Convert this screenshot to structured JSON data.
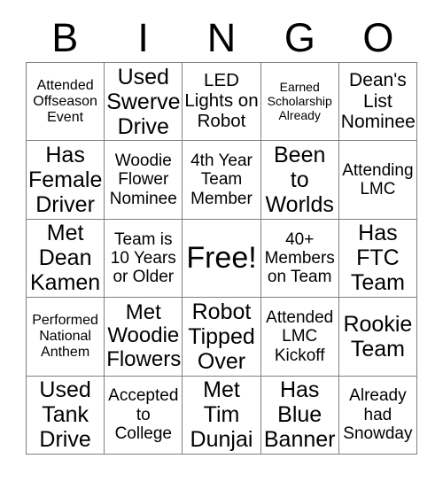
{
  "card": {
    "title": "BINGO",
    "header_letters": [
      "B",
      "I",
      "N",
      "G",
      "O"
    ],
    "columns": 5,
    "rows": 5,
    "free_space": {
      "row": 3,
      "column": 3,
      "label": "Free!"
    },
    "colors": {
      "background": "#ffffff",
      "text": "#000000",
      "grid_line": "#808080"
    },
    "cells": [
      [
        {
          "text": "Attended Offseason Event",
          "size": "sm",
          "free": false
        },
        {
          "text": "Used Swerve Drive",
          "size": "xl",
          "free": false
        },
        {
          "text": "LED Lights on Robot",
          "size": "lg",
          "free": false
        },
        {
          "text": "Earned Scholarship Already",
          "size": "xs",
          "free": false
        },
        {
          "text": "Dean's List Nominee",
          "size": "lg",
          "free": false
        }
      ],
      [
        {
          "text": "Has Female Driver",
          "size": "xl",
          "free": false
        },
        {
          "text": "Woodie Flower Nominee",
          "size": "md",
          "free": false
        },
        {
          "text": "4th Year Team Member",
          "size": "md",
          "free": false
        },
        {
          "text": "Been to Worlds",
          "size": "xl",
          "free": false
        },
        {
          "text": "Attending LMC",
          "size": "md",
          "free": false
        }
      ],
      [
        {
          "text": "Met Dean Kamen",
          "size": "xl",
          "free": false
        },
        {
          "text": "Team is 10 Years or Older",
          "size": "md",
          "free": false
        },
        {
          "text": "Free!",
          "size": "free",
          "free": true
        },
        {
          "text": "40+ Members on Team",
          "size": "md",
          "free": false
        },
        {
          "text": "Has FTC Team",
          "size": "xl",
          "free": false
        }
      ],
      [
        {
          "text": "Performed National Anthem",
          "size": "sm",
          "free": false
        },
        {
          "text": "Met Woodie Flowers",
          "size": "xl",
          "free": false
        },
        {
          "text": "Robot Tipped Over",
          "size": "xl",
          "free": false
        },
        {
          "text": "Attended LMC Kickoff",
          "size": "md",
          "free": false
        },
        {
          "text": "Rookie Team",
          "size": "xl",
          "free": false
        }
      ],
      [
        {
          "text": "Used Tank Drive",
          "size": "xl",
          "free": false
        },
        {
          "text": "Accepted to College",
          "size": "md",
          "free": false
        },
        {
          "text": "Met Tim Dunjai",
          "size": "xl",
          "free": false
        },
        {
          "text": "Has Blue Banner",
          "size": "xl",
          "free": false
        },
        {
          "text": "Already had Snowday",
          "size": "md",
          "free": false
        }
      ]
    ]
  }
}
